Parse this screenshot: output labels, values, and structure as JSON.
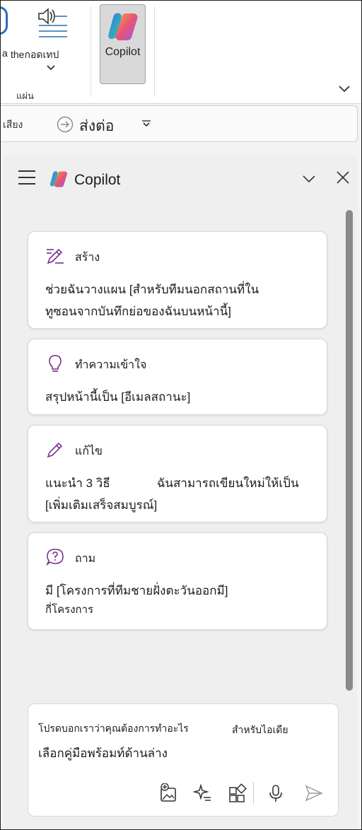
{
  "ribbon": {
    "read_aloud_label_a": "a",
    "read_aloud_label": "theกอดเทป",
    "group_label": "แผ่น",
    "copilot_label": "Copilot"
  },
  "toolbar": {
    "sound_label": "เสียง",
    "forward_label": "ส่งต่อ"
  },
  "pane": {
    "title": "Copilot",
    "cards": [
      {
        "icon": "pencil-sparkle-icon",
        "title": "สร้าง",
        "line1": "ช่วยฉันวางแผน [สำหรับทีมนอกสถานที่ใน",
        "line2": "ทูซอนจากบันทึกย่อของฉันบนหน้านี้]"
      },
      {
        "icon": "lightbulb-icon",
        "title": "ทำความเข้าใจ",
        "line1": "สรุปหน้านี้เป็น [อีเมลสถานะ]",
        "line2": ""
      },
      {
        "icon": "pencil-icon",
        "title": "แก้ไข",
        "line1": "แนะนำ 3 วิธี              ฉันสามารถเขียนใหม่ให้เป็น",
        "line2": "[เพิ่มเติมเสร็จสมบูรณ์]"
      },
      {
        "icon": "question-bubble-icon",
        "title": "ถาม",
        "line1": "มี [โครงการที่ทีมชายฝั่งตะวันออกมี]",
        "line2": "กี่โครงการ"
      }
    ],
    "input": {
      "hint_part1": "โปรดบอกเราว่าคุณต้องการทำอะไร",
      "hint_part2": "สำหรับไอเดีย",
      "hint_line2": "เลือกคู่มือพร้อมท์ด้านล่าง"
    }
  },
  "colors": {
    "accent_purple": "#7a2f8f",
    "copilot_button_bg": "#d9d9d9",
    "pane_bg": "#efefef"
  }
}
